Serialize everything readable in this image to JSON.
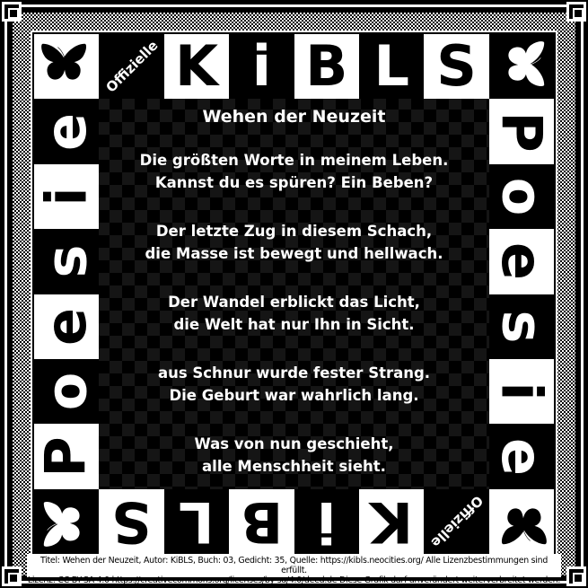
{
  "border_top": {
    "brand": [
      "K",
      "i",
      "B",
      "L",
      "S"
    ],
    "tag": "Offizielle"
  },
  "border_side": {
    "word": [
      "P",
      "o",
      "e",
      "s",
      "i",
      "e"
    ]
  },
  "poem": {
    "title": "Wehen der Neuzeit",
    "stanzas": [
      [
        "Die größten Worte in meinem Leben.",
        "Kannst du es spüren? Ein Beben?"
      ],
      [
        "Der letzte Zug in diesem Schach,",
        "die Masse ist bewegt und hellwach."
      ],
      [
        "Der Wandel erblickt das Licht,",
        "die Welt hat nur Ihn in Sicht."
      ],
      [
        "aus Schnur wurde fester Strang.",
        "Die Geburt war wahrlich lang."
      ],
      [
        "Was von nun geschieht,",
        "alle Menschheit sieht."
      ]
    ]
  },
  "caption": {
    "line1": "Titel: Wehen der Neuzeit, Autor: KiBLS, Buch: 03, Gedicht: 35, Quelle: https://kibls.neocities.org/ Alle Lizenzbestimmungen sind erfüllt.",
    "line2": "Lizenz: CC BY-SA 4.0 https://creativecommons.org/licenses/by-sa/4.0/deed.de Diese Grafik darf unverändert weiterverbreitet werden."
  },
  "icons": {
    "corner": "butterfly-icon"
  }
}
